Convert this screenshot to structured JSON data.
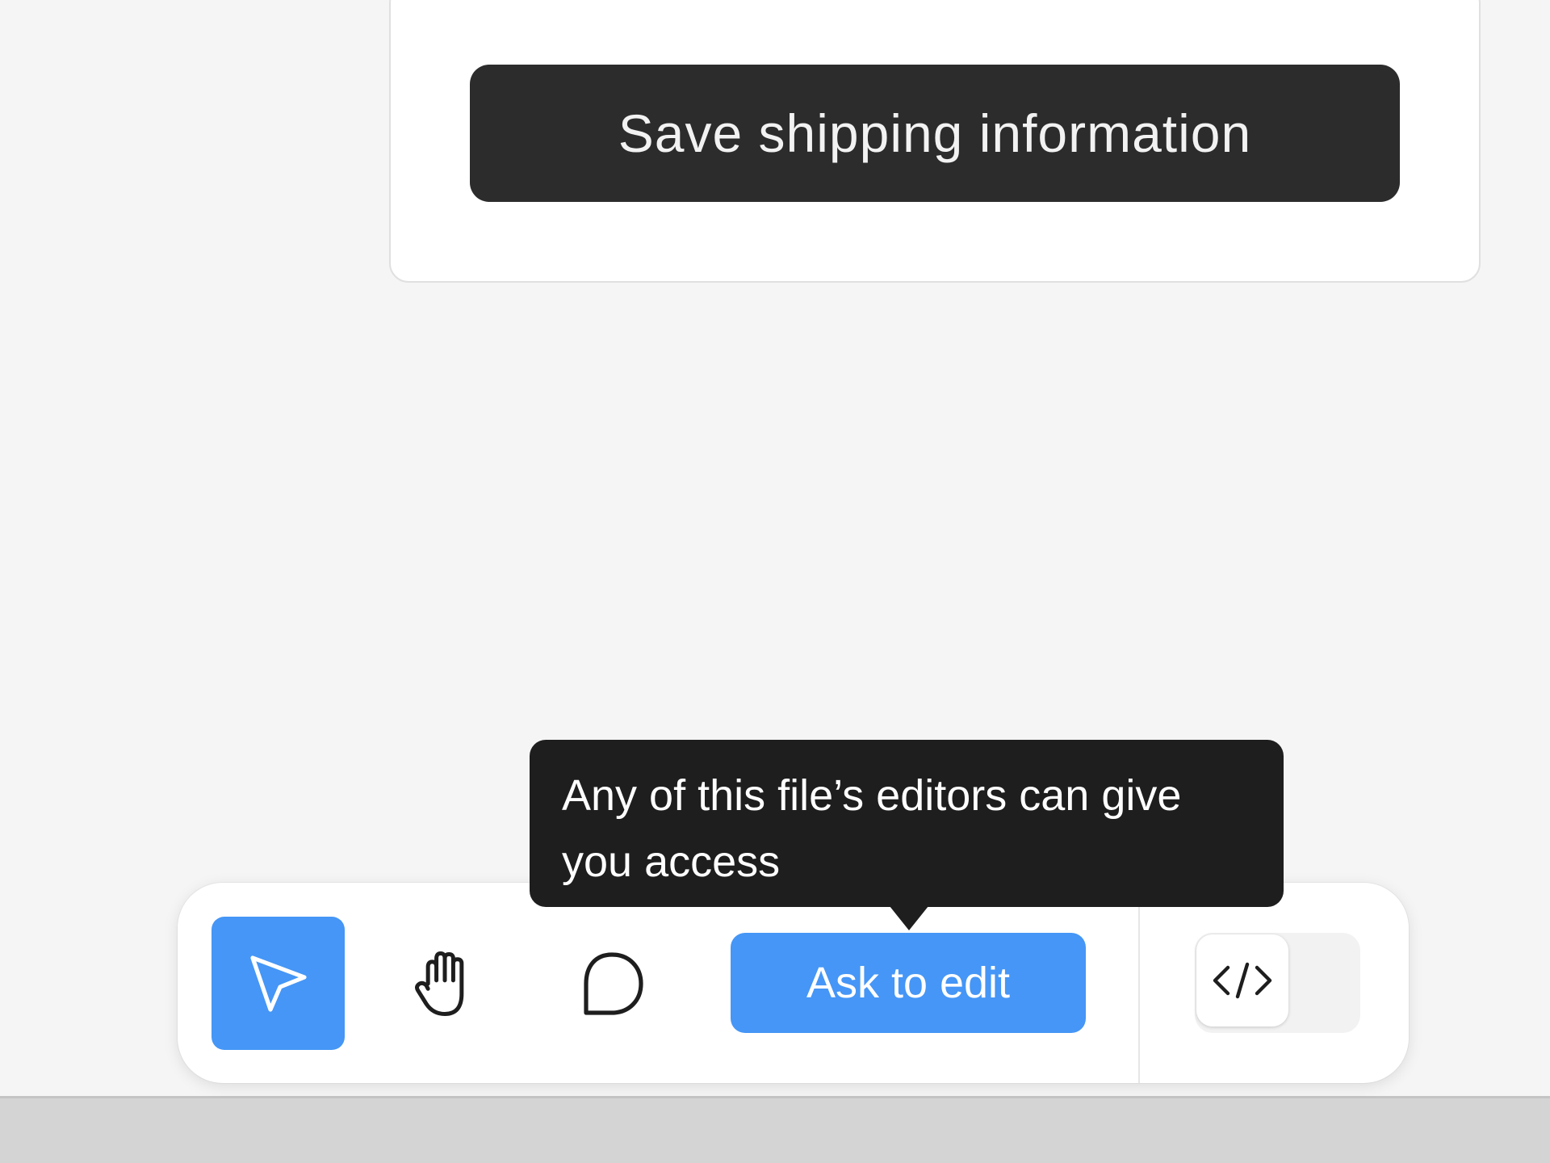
{
  "card": {
    "save_button_label": "Save shipping information"
  },
  "toolbar": {
    "tools": [
      {
        "name": "move",
        "icon": "cursor-arrow-icon",
        "active": true
      },
      {
        "name": "hand",
        "icon": "hand-icon",
        "active": false
      },
      {
        "name": "comment",
        "icon": "comment-bubble-icon",
        "active": false
      }
    ],
    "ask_to_edit_label": "Ask to edit",
    "dev_mode_icon": "code-brackets-icon"
  },
  "tooltip": {
    "text": "Any of this file’s editors can give you access"
  },
  "colors": {
    "accent": "#4596f6",
    "dark_button": "#2c2c2c",
    "tooltip_bg": "#1e1e1e",
    "canvas_bg": "#f5f5f5"
  }
}
